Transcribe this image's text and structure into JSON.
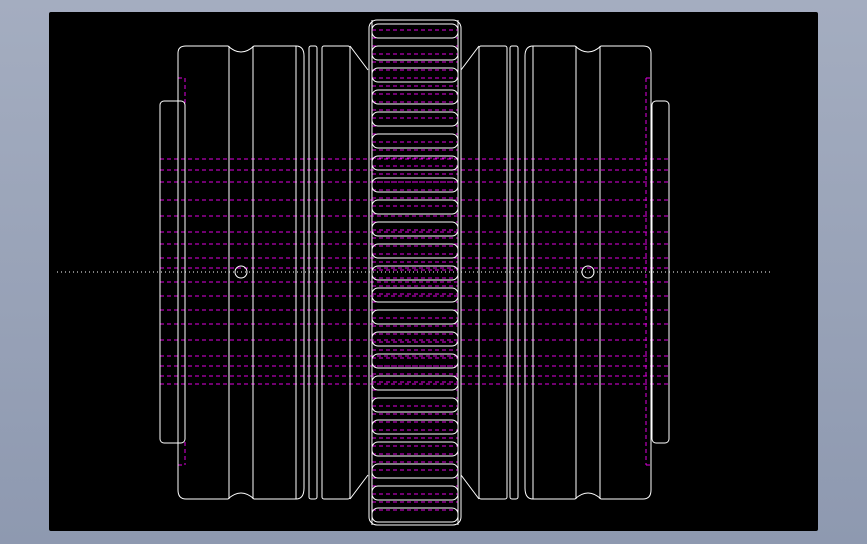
{
  "app": {
    "title": ""
  },
  "colors": {
    "background": "#000000",
    "frame": "#9aa3b8",
    "outline": "#ffffff",
    "hidden_lines": "#e000e0",
    "centerline": "#ffffff"
  },
  "drawing": {
    "subject": "gear-coupling-side-view",
    "line_types": [
      "visible-outline",
      "hidden-dashed",
      "center-dotted"
    ]
  }
}
